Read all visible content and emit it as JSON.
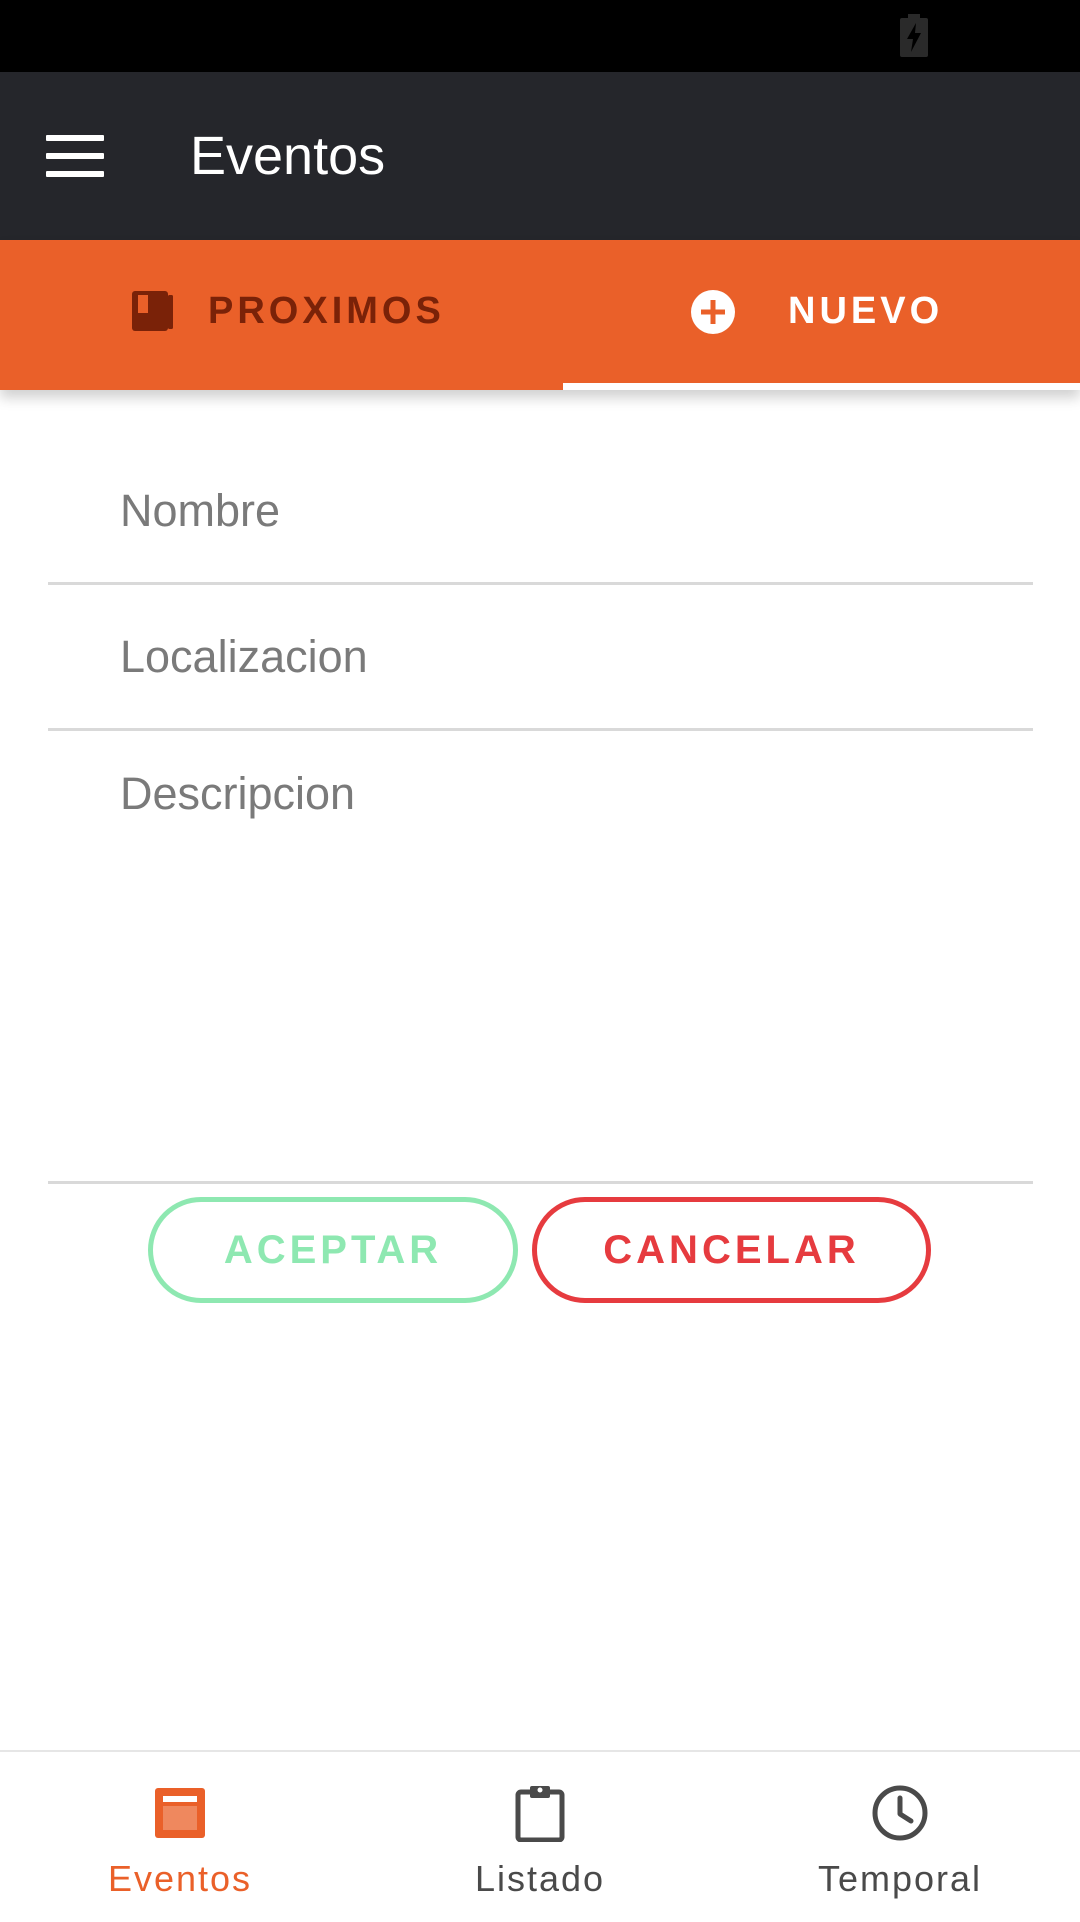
{
  "status_bar": {
    "icons": [
      "battery-charging-icon"
    ]
  },
  "app_bar": {
    "title": "Eventos",
    "menu_icon": "menu-icon"
  },
  "tabs": [
    {
      "label": "PROXIMOS",
      "icon": "book-icon",
      "selected": false
    },
    {
      "label": "NUEVO",
      "icon": "plus-circle-icon",
      "selected": true
    }
  ],
  "form": {
    "nombre": {
      "value": "",
      "placeholder": "Nombre"
    },
    "localizacion": {
      "value": "",
      "placeholder": "Localizacion"
    },
    "descripcion": {
      "value": "",
      "placeholder": "Descripcion"
    }
  },
  "actions": {
    "accept_label": "ACEPTAR",
    "cancel_label": "CANCELAR"
  },
  "bottom_nav": [
    {
      "label": "Eventos",
      "icon": "calendar-page-icon",
      "selected": true
    },
    {
      "label": "Listado",
      "icon": "clipboard-icon",
      "selected": false
    },
    {
      "label": "Temporal",
      "icon": "clock-icon",
      "selected": false
    }
  ],
  "colors": {
    "app_bar": "#25262b",
    "accent": "#ea6029",
    "accept": "#8ee8b1",
    "cancel": "#e63b3f",
    "inactive_tab_text": "#7a2208"
  }
}
